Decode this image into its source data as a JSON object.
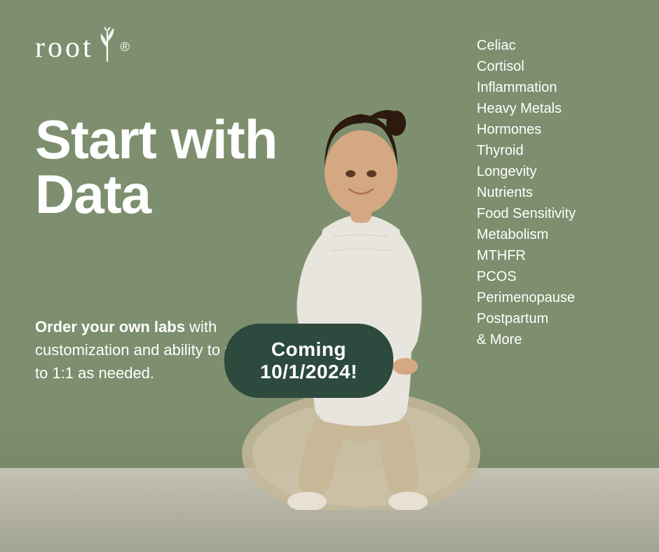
{
  "app": {
    "background_color": "#7d8f6e",
    "floor_color": "#d4cfc4"
  },
  "logo": {
    "text": "root",
    "registered": "®"
  },
  "headline": {
    "line1": "Start with",
    "line2": "Data"
  },
  "subtext": {
    "bold_part": "Order your own labs",
    "rest": " with customization and ability to upgrade to 1:1 as needed."
  },
  "cta": {
    "label": "Coming 10/1/2024!"
  },
  "list": {
    "items": [
      "Celiac",
      "Cortisol",
      "Inflammation",
      "Heavy Metals",
      "Hormones",
      "Thyroid",
      "Longevity",
      "Nutrients",
      "Food Sensitivity",
      "Metabolism",
      "MTHFR",
      "PCOS",
      "Perimenopause",
      "Postpartum",
      "& More"
    ]
  }
}
